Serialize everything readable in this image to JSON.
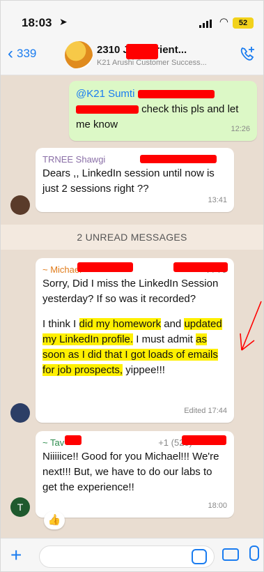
{
  "status": {
    "time": "18:03",
    "battery": "52"
  },
  "header": {
    "back_count": "339",
    "group_name": "2310 JOB Orient...",
    "group_subtitle": "K21 Arushi Customer Success..."
  },
  "messages": [
    {
      "type": "outgoing",
      "mention": "@K21 Sumti",
      "text": "check this pls and let me know",
      "time": "12:26"
    },
    {
      "type": "incoming",
      "sender": "TRNEE Shawgi",
      "text": "Dears ,,  LinkedIn session until now is just 2 sessions right ??",
      "time": "13:41"
    },
    {
      "type": "incoming",
      "sender": "~ Michael",
      "phone": "+44 79",
      "para1": "Sorry, Did I miss the LinkedIn Session yesterday? If so was it recorded?",
      "p2_a": "I think I ",
      "p2_b": "did my homework",
      "p2_c": " and ",
      "p2_d": "updated my LinkedIn profile.",
      "p2_e": " I must admit ",
      "p2_f": "as soon as I did that I got loads of emails for job prospects,",
      "p2_g": " yippee!!!",
      "time": "Edited 17:44"
    },
    {
      "type": "incoming",
      "sender": "~ Tav",
      "phone": "+1 (520)",
      "text": "Niiiiice!!  Good for you Michael!!! We're next!!!  But, we have to do our labs to get the experience!!",
      "time": "18:00",
      "avatar_letter": "T",
      "reaction": "👍"
    }
  ],
  "unread_label": "2 UNREAD MESSAGES",
  "colors": {
    "accent": "#1a7cf0",
    "outgoing": "#dcf8c6",
    "chat_bg": "#e9ddd1",
    "highlight": "#fff000"
  }
}
